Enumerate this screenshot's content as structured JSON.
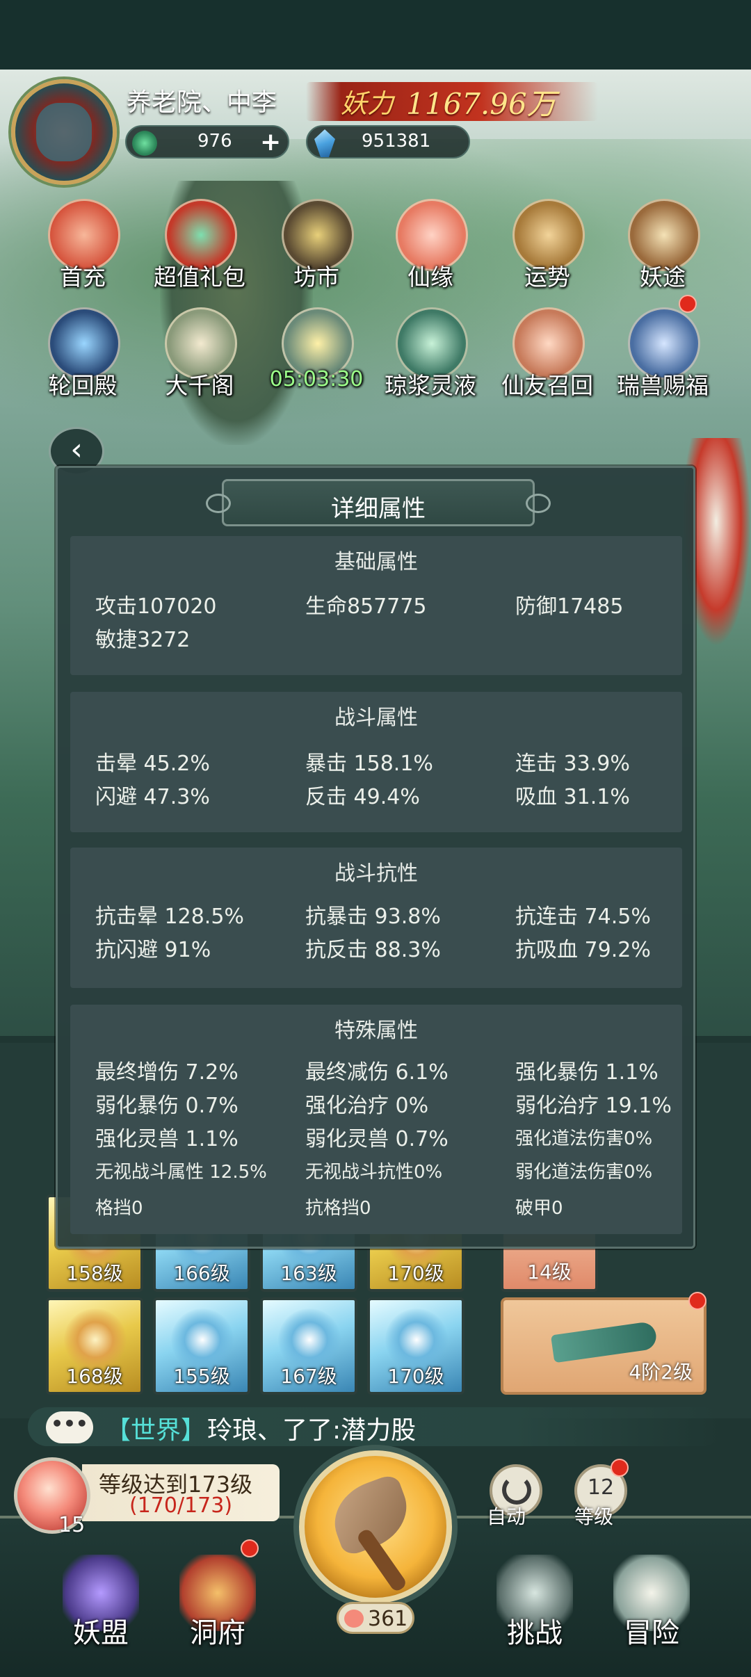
{
  "player": {
    "name": "养老院、中李",
    "power_label": "妖力",
    "power_value": "1167.96万",
    "jade": "976",
    "crystals": "951381"
  },
  "menu_row1": [
    {
      "label": "首充",
      "icon": "gift-pouch-icon"
    },
    {
      "label": "超值礼包",
      "icon": "gem-bag-icon"
    },
    {
      "label": "坊市",
      "icon": "coin-market-icon"
    },
    {
      "label": "仙缘",
      "icon": "lotus-icon"
    },
    {
      "label": "运势",
      "icon": "fortune-sticks-icon"
    },
    {
      "label": "妖途",
      "icon": "book-icon"
    }
  ],
  "menu_row2": [
    {
      "label": "轮回殿",
      "icon": "palace-icon"
    },
    {
      "label": "大千阁",
      "icon": "scroll-icon"
    },
    {
      "label": "05:03:30",
      "icon": "pagoda-icon"
    },
    {
      "label": "琼浆灵液",
      "icon": "gourd-icon"
    },
    {
      "label": "仙友召回",
      "icon": "pig-friend-icon"
    },
    {
      "label": "瑞兽赐福",
      "icon": "beast-icon"
    }
  ],
  "panel": {
    "title": "详细属性",
    "basic": {
      "title": "基础属性",
      "stats": [
        "攻击107020",
        "生命857775",
        "防御17485",
        "敏捷3272"
      ]
    },
    "combat": {
      "title": "战斗属性",
      "stats": [
        "击晕 45.2%",
        "暴击 158.1%",
        "连击 33.9%",
        "闪避 47.3%",
        "反击 49.4%",
        "吸血 31.1%"
      ]
    },
    "resist": {
      "title": "战斗抗性",
      "stats": [
        "抗击晕 128.5%",
        "抗暴击 93.8%",
        "抗连击 74.5%",
        "抗闪避 91%",
        "抗反击 88.3%",
        "抗吸血 79.2%"
      ]
    },
    "special": {
      "title": "特殊属性",
      "stats": [
        "最终增伤 7.2%",
        "最终减伤 6.1%",
        "强化暴伤 1.1%",
        "弱化暴伤 0.7%",
        "强化治疗 0%",
        "弱化治疗 19.1%",
        "强化灵兽 1.1%",
        "弱化灵兽 0.7%",
        "强化道法伤害0%",
        "无视战斗属性 12.5%",
        "无视战斗抗性0%",
        "弱化道法伤害0%",
        "格挡0",
        "抗格挡0",
        "破甲0"
      ]
    }
  },
  "equipment": {
    "row1": [
      "158级",
      "166级",
      "163级",
      "170级"
    ],
    "row2": [
      "168级",
      "155级",
      "167级",
      "170级"
    ],
    "side_card": "14级",
    "weapon": "4阶2级"
  },
  "chat": {
    "channel": "【世界】",
    "message": "玲琅、了了:潜力股"
  },
  "hud": {
    "peach_count": "15",
    "level_goal": "等级达到173级",
    "level_progress": "(170/173)",
    "stamina": "361",
    "auto_label": "自动",
    "level_num": "12",
    "level_label": "等级",
    "buttons": [
      "妖盟",
      "洞府",
      "挑战",
      "冒险"
    ]
  }
}
